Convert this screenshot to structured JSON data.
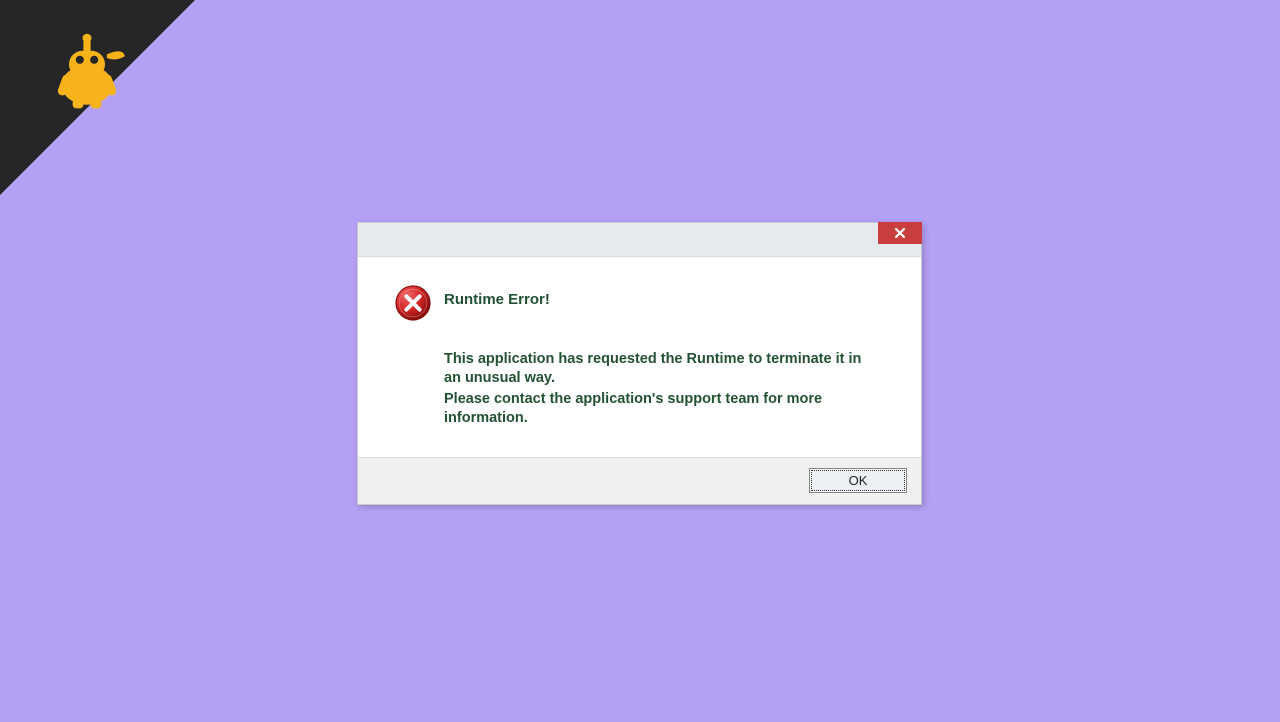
{
  "dialog": {
    "close_tooltip": "Close",
    "title": "Runtime Error!",
    "body_line1": "This application has requested the Runtime to terminate it in an unusual way.",
    "body_line2": "Please contact the application's support team for more information.",
    "ok_label": "OK"
  }
}
